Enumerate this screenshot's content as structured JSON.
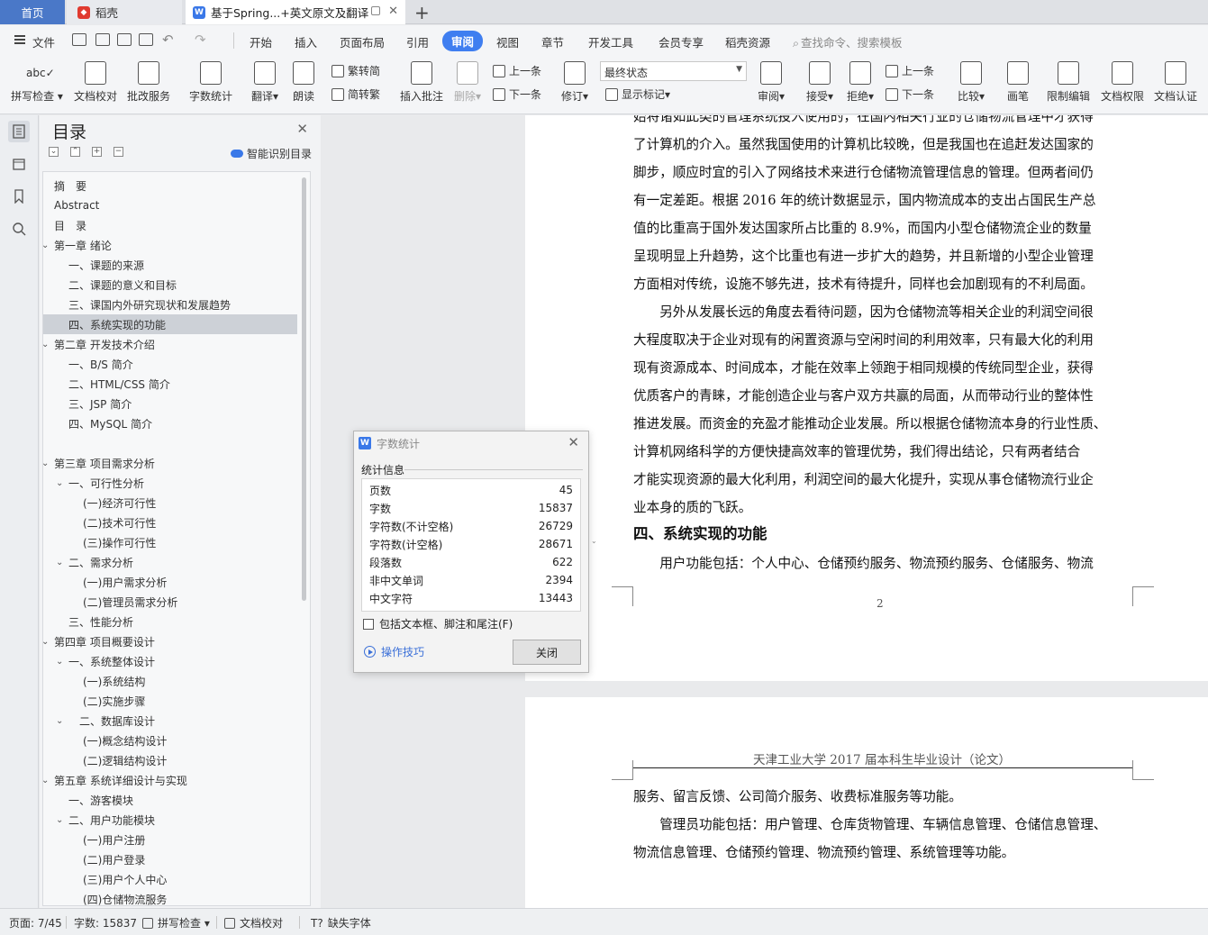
{
  "tabs": {
    "home": "首页",
    "daoke": "稻壳",
    "doc": "基于Spring...+英文原文及翻译"
  },
  "menu": {
    "file": "文件",
    "items": [
      "开始",
      "插入",
      "页面布局",
      "引用",
      "审阅",
      "视图",
      "章节",
      "开发工具",
      "会员专享",
      "稻壳资源"
    ],
    "active": "审阅",
    "search": "查找命令、搜索模板"
  },
  "ribbon": {
    "spell": "拼写检查",
    "doc_check": "文档校对",
    "batch": "批改服务",
    "word_count": "字数统计",
    "translate": "翻译",
    "read": "朗读",
    "trad": "繁转简",
    "simp": "简转繁",
    "insert_comment": "插入批注",
    "delete": "删除",
    "prev": "上一条",
    "next": "下一条",
    "revise": "修订",
    "final_state": "最终状态",
    "show_marks": "显示标记",
    "review": "审阅",
    "accept": "接受",
    "reject": "拒绝",
    "prev2": "上一条",
    "next2": "下一条",
    "compare": "比较",
    "pen": "画笔",
    "restrict": "限制编辑",
    "rights": "文档权限",
    "certify": "文档认证"
  },
  "outline": {
    "title": "目录",
    "smart": "智能识别目录",
    "items": [
      {
        "label": "摘　要",
        "level": 0,
        "caret": ""
      },
      {
        "label": "Abstract",
        "level": 0,
        "caret": ""
      },
      {
        "label": "目　录",
        "level": 0,
        "caret": ""
      },
      {
        "label": "第一章 绪论",
        "level": 0,
        "caret": "v"
      },
      {
        "label": "一、课题的来源",
        "level": 1,
        "caret": ""
      },
      {
        "label": "二、课题的意义和目标",
        "level": 1,
        "caret": ""
      },
      {
        "label": "三、课国内外研究现状和发展趋势",
        "level": 1,
        "caret": ""
      },
      {
        "label": "四、系统实现的功能",
        "level": 1,
        "caret": ""
      },
      {
        "label": "第二章 开发技术介绍",
        "level": 0,
        "caret": "v"
      },
      {
        "label": "一、B/S 简介",
        "level": 1,
        "caret": ""
      },
      {
        "label": "二、HTML/CSS 简介",
        "level": 1,
        "caret": ""
      },
      {
        "label": "三、JSP 简介",
        "level": 1,
        "caret": ""
      },
      {
        "label": "四、MySQL 简介",
        "level": 1,
        "caret": ""
      },
      {
        "label": "",
        "level": 1,
        "caret": ""
      },
      {
        "label": "第三章 项目需求分析",
        "level": 0,
        "caret": "v"
      },
      {
        "label": "一、可行性分析",
        "level": 1,
        "caret": "v"
      },
      {
        "label": "(一)经济可行性",
        "level": 2,
        "caret": ""
      },
      {
        "label": "(二)技术可行性",
        "level": 2,
        "caret": ""
      },
      {
        "label": "(三)操作可行性",
        "level": 2,
        "caret": ""
      },
      {
        "label": "二、需求分析",
        "level": 1,
        "caret": "v"
      },
      {
        "label": "(一)用户需求分析",
        "level": 2,
        "caret": ""
      },
      {
        "label": "(二)管理员需求分析",
        "level": 2,
        "caret": ""
      },
      {
        "label": "三、性能分析",
        "level": 1,
        "caret": ""
      },
      {
        "label": "第四章 项目概要设计",
        "level": 0,
        "caret": "v"
      },
      {
        "label": "一、系统整体设计",
        "level": 1,
        "caret": "v"
      },
      {
        "label": "(一)系统结构",
        "level": 2,
        "caret": ""
      },
      {
        "label": "(二)实施步骤",
        "level": 2,
        "caret": ""
      },
      {
        "label": "　二、数据库设计",
        "level": 1,
        "caret": "v"
      },
      {
        "label": "(一)概念结构设计",
        "level": 2,
        "caret": ""
      },
      {
        "label": "(二)逻辑结构设计",
        "level": 2,
        "caret": ""
      },
      {
        "label": "第五章 系统详细设计与实现",
        "level": 0,
        "caret": "v"
      },
      {
        "label": "一、游客模块",
        "level": 1,
        "caret": ""
      },
      {
        "label": "二、用户功能模块",
        "level": 1,
        "caret": "v"
      },
      {
        "label": "(一)用户注册",
        "level": 2,
        "caret": ""
      },
      {
        "label": "(二)用户登录",
        "level": 2,
        "caret": ""
      },
      {
        "label": "(三)用户个人中心",
        "level": 2,
        "caret": ""
      },
      {
        "label": "(四)仓储物流服务",
        "level": 2,
        "caret": ""
      }
    ],
    "selected_index": 7
  },
  "document": {
    "page1_lines": [
      "始将诸如此类的管理系统投入使用的，在国内相关行业的仓储物流管理中才获得",
      "了计算机的介入。虽然我国使用的计算机比较晚，但是我国也在追赶发达国家的",
      "脚步，顺应时宜的引入了网络技术来进行仓储物流管理信息的管理。但两者间仍",
      "有一定差距。根据 2016 年的统计数据显示，国内物流成本的支出占国民生产总",
      "值的比重高于国外发达国家所占比重的 8.9%，而国内小型仓储物流企业的数量",
      "呈现明显上升趋势，这个比重也有进一步扩大的趋势，并且新增的小型企业管理",
      "方面相对传统，设施不够先进，技术有待提升，同样也会加剧现有的不利局面。",
      "　　另外从发展长远的角度去看待问题，因为仓储物流等相关企业的利润空间很",
      "大程度取决于企业对现有的闲置资源与空闲时间的利用效率，只有最大化的利用",
      "现有资源成本、时间成本，才能在效率上领跑于相同规模的传统同型企业，获得",
      "优质客户的青睐，才能创造企业与客户双方共赢的局面，从而带动行业的整体性",
      "推进发展。而资金的充盈才能推动企业发展。所以根据仓储物流本身的行业性质、",
      "计算机网络科学的方便快捷高效率的管理优势，我们得出结论，只有两者结合",
      "才能实现资源的最大化利用，利润空间的最大化提升，实现从事仓储物流行业企",
      "业本身的质的飞跃。"
    ],
    "heading": "四、系统实现的功能",
    "page1_after": "　　用户功能包括：个人中心、仓储预约服务、物流预约服务、仓储服务、物流",
    "page_number": "2",
    "page2_header": "天津工业大学 2017 届本科生毕业设计（论文）",
    "page2_lines": [
      "服务、留言反馈、公司简介服务、收费标准服务等功能。",
      "　　管理员功能包括：用户管理、仓库货物管理、车辆信息管理、仓储信息管理、",
      "物流信息管理、仓储预约管理、物流预约管理、系统管理等功能。"
    ]
  },
  "dialog": {
    "title": "字数统计",
    "section": "统计信息",
    "rows": [
      {
        "label": "页数",
        "value": "45"
      },
      {
        "label": "字数",
        "value": "15837"
      },
      {
        "label": "字符数(不计空格)",
        "value": "26729"
      },
      {
        "label": "字符数(计空格)",
        "value": "28671"
      },
      {
        "label": "段落数",
        "value": "622"
      },
      {
        "label": "非中文单词",
        "value": "2394"
      },
      {
        "label": "中文字符",
        "value": "13443"
      }
    ],
    "checkbox": "包括文本框、脚注和尾注(F)",
    "tips": "操作技巧",
    "close": "关闭"
  },
  "statusbar": {
    "page": "页面: 7/45",
    "words": "字数: 15837",
    "spell": "拼写检查",
    "check": "文档校对",
    "missing_font": "缺失字体"
  },
  "colors": {
    "accent": "#3f7ef0",
    "home_tab": "#4a78c8",
    "daoke_logo": "#e03a2f"
  }
}
